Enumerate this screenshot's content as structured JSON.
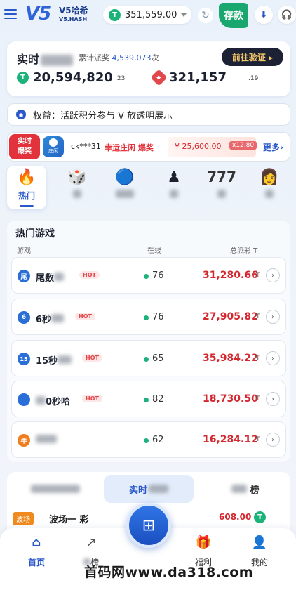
{
  "header": {
    "logo": "V5",
    "app_name": "V5哈希",
    "app_sub": "V5.HASH",
    "coin_symbol": "T",
    "balance": "351,559.00",
    "refresh_icon": "refresh-icon",
    "deposit_label": "存款",
    "download_icon": "download-icon",
    "support_icon": "headset-icon"
  },
  "stats": {
    "title": "实时",
    "cumulative_label": "累计派奖",
    "cumulative_value": "4,539,073",
    "cumulative_unit": "次",
    "verify_button": "前往验证 ▸",
    "primary_value": "20,594,820",
    "primary_decimal": ".23",
    "secondary_value": "321,157",
    "secondary_decimal": ".19"
  },
  "notice": {
    "text": "权益：活跃积分参与 V 放透明展示"
  },
  "jackpot": {
    "badge_line1": "实时",
    "badge_line2": "爆奖",
    "game_icon_label": "庄闲",
    "user": "ck***31",
    "desc": "幸运庄闲 爆奖",
    "amount": "¥ 25,600.00",
    "multiplier": "x12.80",
    "more": "更多›"
  },
  "categories": [
    {
      "icon": "🔥",
      "label": "热门",
      "active": true
    },
    {
      "icon": "🎲",
      "label": ""
    },
    {
      "icon": "🔵",
      "label": ""
    },
    {
      "icon": "♟",
      "label": ""
    },
    {
      "icon": "777",
      "label": ""
    },
    {
      "icon": "👩",
      "label": ""
    }
  ],
  "hot_games": {
    "title": "热门游戏",
    "col_game": "游戏",
    "col_online": "在线",
    "col_total": "总派彩 T",
    "hot_label": "HOT",
    "unit": "T",
    "rows": [
      {
        "icon_text": "尾",
        "name": "尾数",
        "online": "76",
        "amount": "31,280.66",
        "icon_color": "#2a6fd8"
      },
      {
        "icon_text": "6",
        "name": "6秒",
        "online": "76",
        "amount": "27,905.82",
        "icon_color": "#2a6fd8"
      },
      {
        "icon_text": "15",
        "name": "15秒",
        "online": "65",
        "amount": "35,984.22",
        "icon_color": "#2a6fd8"
      },
      {
        "icon_text": "",
        "name": "0秒哈",
        "online": "82",
        "amount": "18,730.50",
        "icon_color": "#2a6fd8"
      },
      {
        "icon_text": "牛",
        "name": "",
        "online": "62",
        "amount": "16,284.12",
        "icon_color": "#f07d1e"
      }
    ]
  },
  "bottom_tabs": {
    "tab1": "",
    "tab2": "实时",
    "tab3": "榜"
  },
  "feed": {
    "badge": "波场",
    "name": "波场一 彩",
    "amount": "608.00"
  },
  "nav": {
    "home": "首页",
    "item2": "榜",
    "item3": "",
    "welfare": "福利",
    "mine": "我的"
  },
  "watermark": "首码网www.da318.com"
}
